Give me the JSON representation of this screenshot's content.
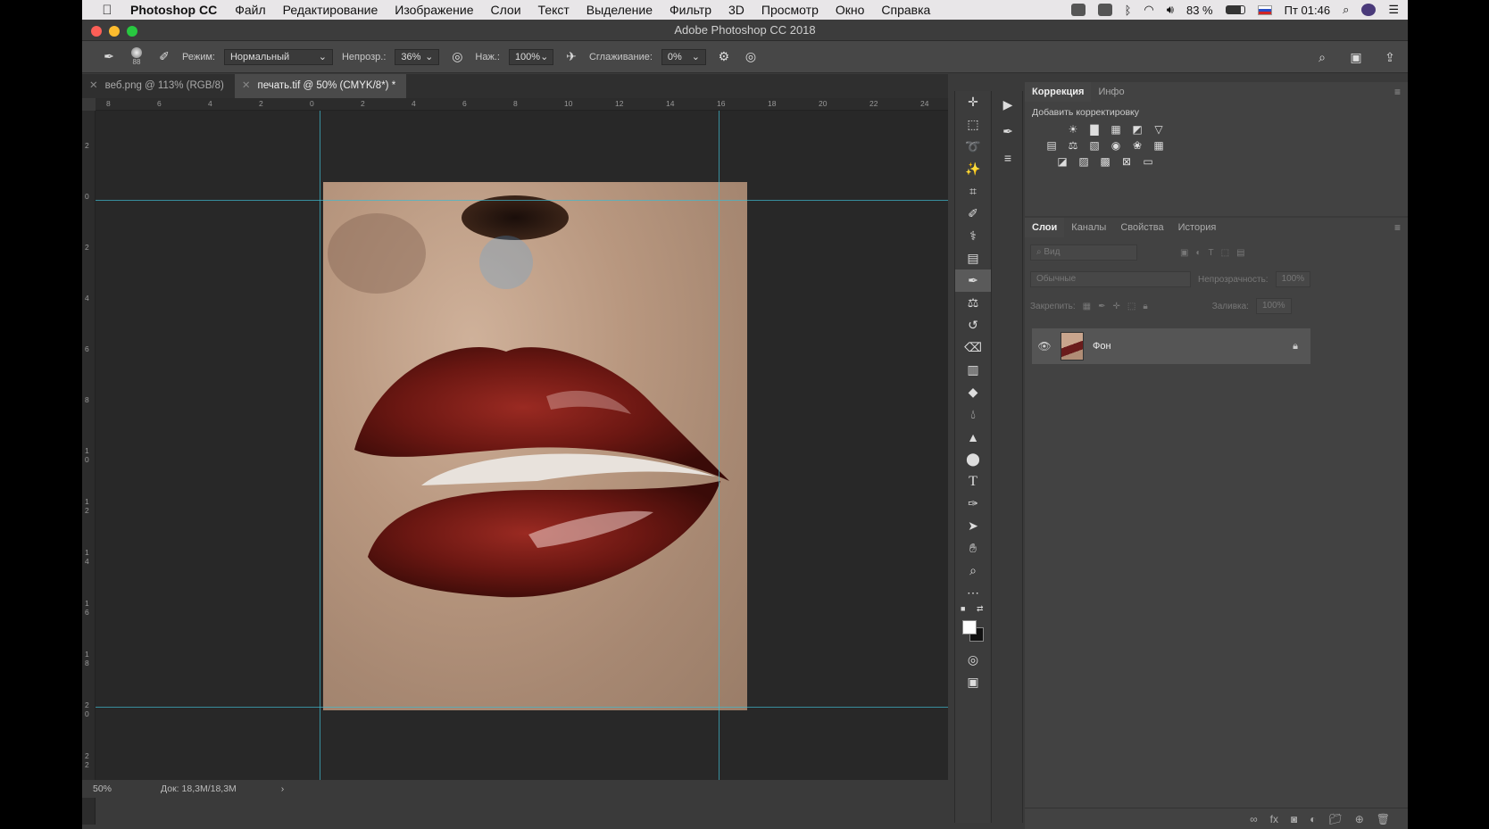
{
  "menubar": {
    "apple": "",
    "app_name": "Photoshop CC",
    "items": [
      "Файл",
      "Редактирование",
      "Изображение",
      "Слои",
      "Текст",
      "Выделение",
      "Фильтр",
      "3D",
      "Просмотр",
      "Окно",
      "Справка"
    ],
    "battery": "83 %",
    "clock": "Пт 01:46"
  },
  "window": {
    "title": "Adobe Photoshop CC 2018"
  },
  "options": {
    "brush_size": "88",
    "mode_label": "Режим:",
    "mode_value": "Нормальный",
    "opacity_label": "Непрозр.:",
    "opacity_value": "36%",
    "pressure_label": "Наж.:",
    "pressure_value": "100%",
    "smoothing_label": "Сглаживание:",
    "smoothing_value": "0%"
  },
  "tabs": [
    {
      "label": "веб.png @ 113% (RGB/8)"
    },
    {
      "label": "печать.tif @ 50% (CMYK/8*) *"
    }
  ],
  "ruler": {
    "top": [
      "8",
      "6",
      "4",
      "2",
      "0",
      "2",
      "4",
      "6",
      "8",
      "10",
      "12",
      "14",
      "16",
      "18",
      "20",
      "22",
      "24"
    ],
    "left": [
      "2",
      "0",
      "2",
      "4",
      "6",
      "8",
      "1 0",
      "1 2",
      "1 4",
      "1 6",
      "1 8",
      "2 0",
      "2 2"
    ]
  },
  "status": {
    "zoom": "50%",
    "doc": "Док: 18,3M/18,3M",
    "arrow": "›"
  },
  "adjustments": {
    "tabs": [
      "Коррекция",
      "Инфо"
    ],
    "subtitle": "Добавить корректировку"
  },
  "layers": {
    "tabs": [
      "Слои",
      "Каналы",
      "Свойства",
      "История"
    ],
    "search_placeholder": "Вид",
    "blend_mode": "Обычные",
    "opacity_label": "Непрозрачность:",
    "opacity_value": "100%",
    "lock_label": "Закрепить:",
    "fill_label": "Заливка:",
    "fill_value": "100%",
    "items": [
      {
        "name": "Фон"
      }
    ]
  }
}
